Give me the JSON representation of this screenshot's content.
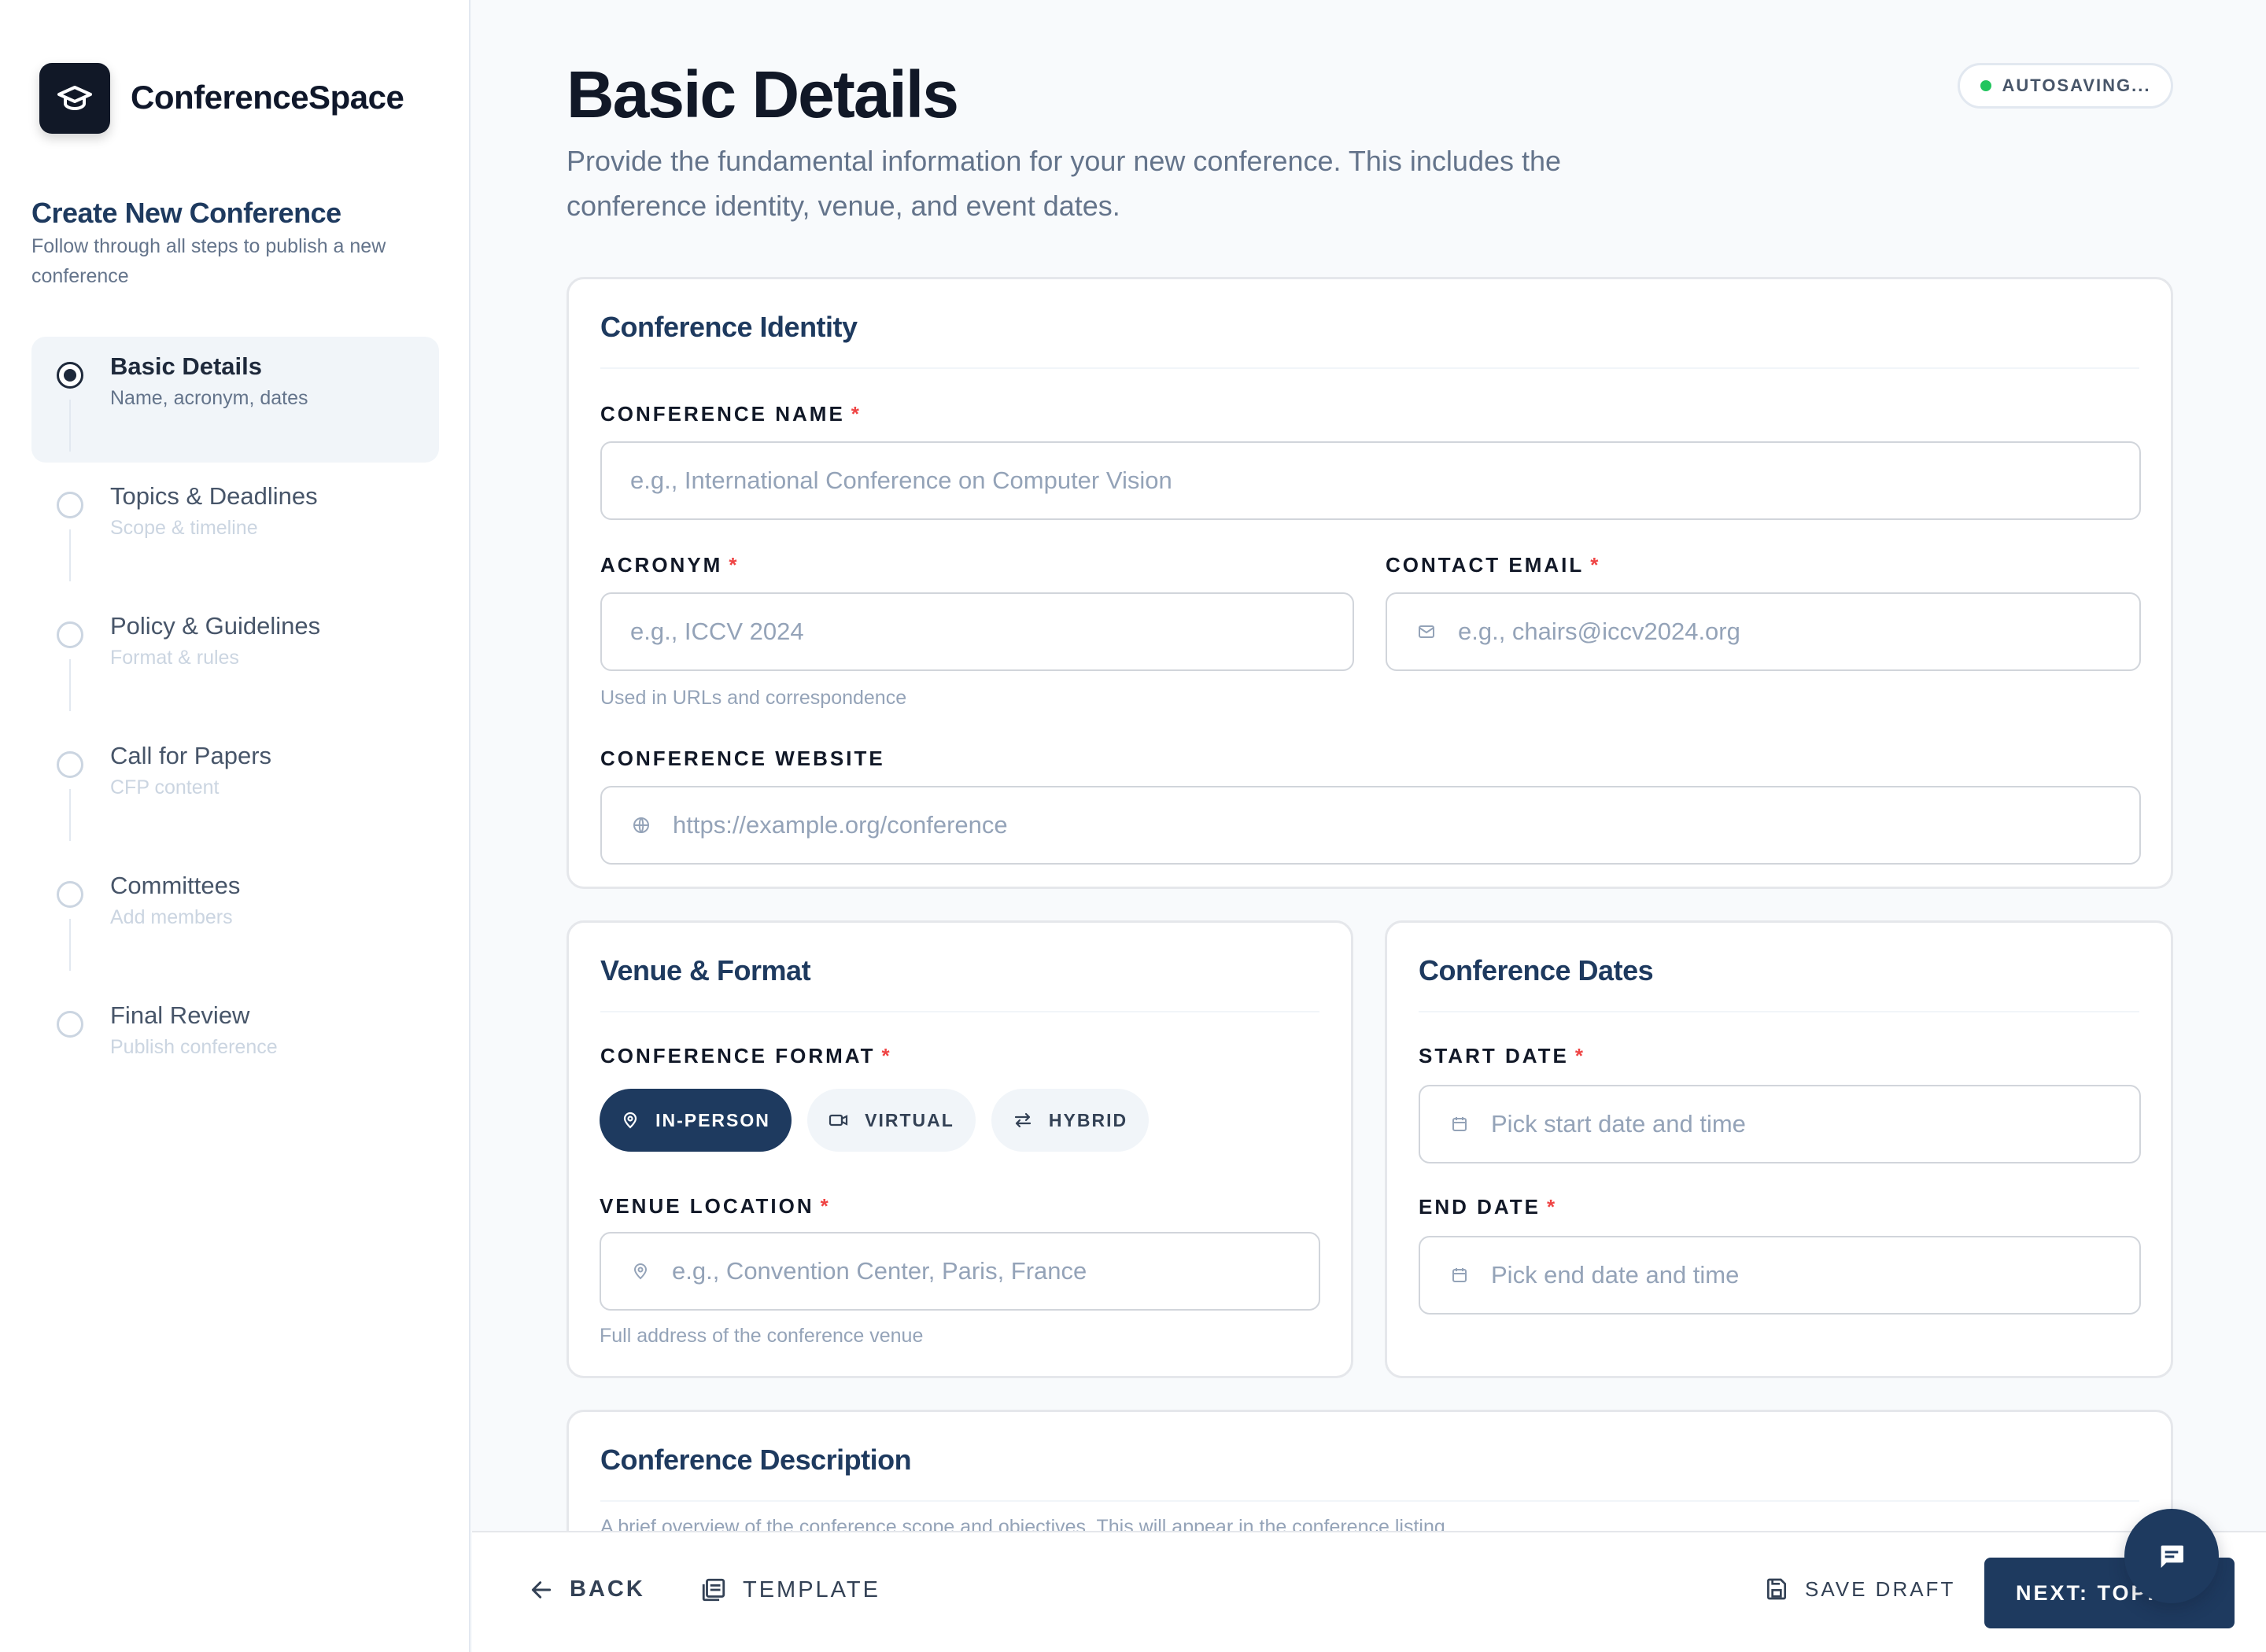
{
  "app": {
    "name": "ConferenceSpace"
  },
  "sidebar": {
    "title": "Create New Conference",
    "subtitle": "Follow through all steps to publish a new conference",
    "steps": [
      {
        "label": "Basic Details",
        "desc": "Name, acronym, dates",
        "active": true
      },
      {
        "label": "Topics & Deadlines",
        "desc": "Scope & timeline",
        "active": false
      },
      {
        "label": "Policy & Guidelines",
        "desc": "Format & rules",
        "active": false
      },
      {
        "label": "Call for Papers",
        "desc": "CFP content",
        "active": false
      },
      {
        "label": "Committees",
        "desc": "Add members",
        "active": false
      },
      {
        "label": "Final Review",
        "desc": "Publish conference",
        "active": false
      }
    ]
  },
  "header": {
    "title": "Basic Details",
    "subtitle": "Provide the fundamental information for your new conference. This includes the conference identity, venue, and event dates.",
    "autosave": "AUTOSAVING..."
  },
  "identity": {
    "title": "Conference Identity",
    "name_label": "CONFERENCE NAME",
    "name_placeholder": "e.g., International Conference on Computer Vision",
    "acronym_label": "ACRONYM",
    "acronym_placeholder": "e.g., ICCV 2024",
    "acronym_hint": "Used in URLs and correspondence",
    "email_label": "CONTACT EMAIL",
    "email_placeholder": "e.g., chairs@iccv2024.org",
    "website_label": "CONFERENCE WEBSITE",
    "website_placeholder": "https://example.org/conference"
  },
  "venue": {
    "title": "Venue & Format",
    "format_label": "CONFERENCE FORMAT",
    "formats": [
      {
        "label": "IN-PERSON",
        "icon": "map-pin-icon",
        "selected": true
      },
      {
        "label": "VIRTUAL",
        "icon": "video-icon",
        "selected": false
      },
      {
        "label": "HYBRID",
        "icon": "swap-arrows-icon",
        "selected": false
      }
    ],
    "location_label": "VENUE LOCATION",
    "location_placeholder": "e.g., Convention Center, Paris, France",
    "location_hint": "Full address of the conference venue"
  },
  "dates": {
    "title": "Conference Dates",
    "start_label": "START DATE",
    "start_placeholder": "Pick start date and time",
    "end_label": "END DATE",
    "end_placeholder": "Pick end date and time"
  },
  "description": {
    "title": "Conference Description",
    "hint": "A brief overview of the conference scope and objectives. This will appear in the conference listing."
  },
  "footer": {
    "back": "BACK",
    "template": "TEMPLATE",
    "save_draft": "SAVE DRAFT",
    "next": "NEXT: TOPICS"
  },
  "colors": {
    "primary": "#1e3a5f",
    "required": "#ef4444",
    "autosave_dot": "#22c55e",
    "background": "#f8fafc"
  }
}
